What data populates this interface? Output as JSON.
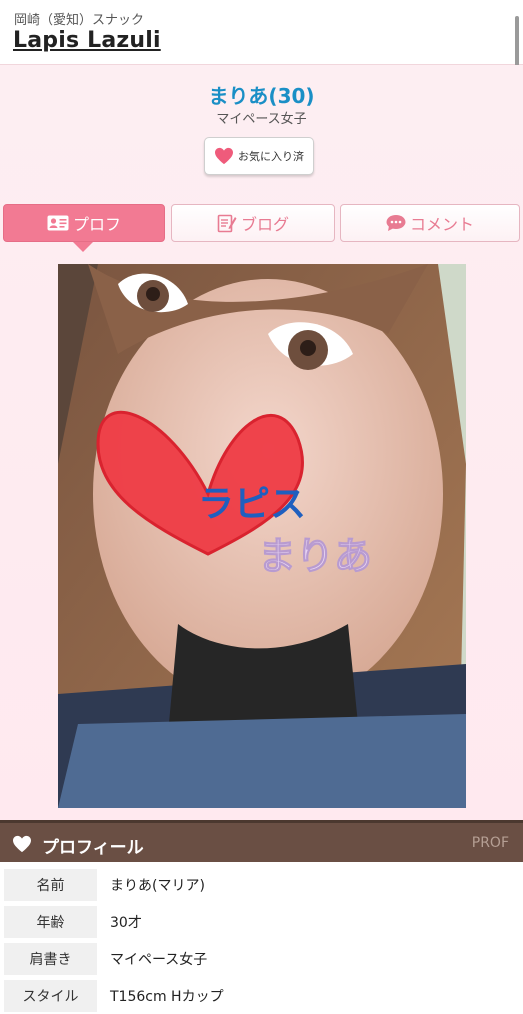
{
  "header": {
    "area": "岡崎（愛知）スナック",
    "shop_name": "Lapis Lazuli"
  },
  "cast": {
    "name": "まりあ(30)",
    "catch": "マイペース女子"
  },
  "favorite_button": {
    "label": "お気に入り済",
    "icon": "heart-icon"
  },
  "tabs": [
    {
      "label": "プロフ",
      "icon": "profile-card-icon",
      "active": true
    },
    {
      "label": "ブログ",
      "icon": "blog-edit-icon",
      "active": false
    },
    {
      "label": "コメント",
      "icon": "comment-bubble-icon",
      "active": false
    }
  ],
  "photo": {
    "overlay_line1": "ラピス",
    "overlay_line2": "まりあ"
  },
  "section": {
    "title": "プロフィール",
    "subtitle": "PROF",
    "icon": "heart-icon"
  },
  "profile_rows": [
    {
      "key": "名前",
      "value": "まりあ(マリア)"
    },
    {
      "key": "年齢",
      "value": "30才"
    },
    {
      "key": "肩書き",
      "value": "マイペース女子"
    },
    {
      "key": "スタイル",
      "value": "T156cm Hカップ"
    }
  ],
  "colors": {
    "accent_pink": "#f27a93",
    "name_blue": "#1a8fc6",
    "section_brown": "#6a4f44"
  }
}
